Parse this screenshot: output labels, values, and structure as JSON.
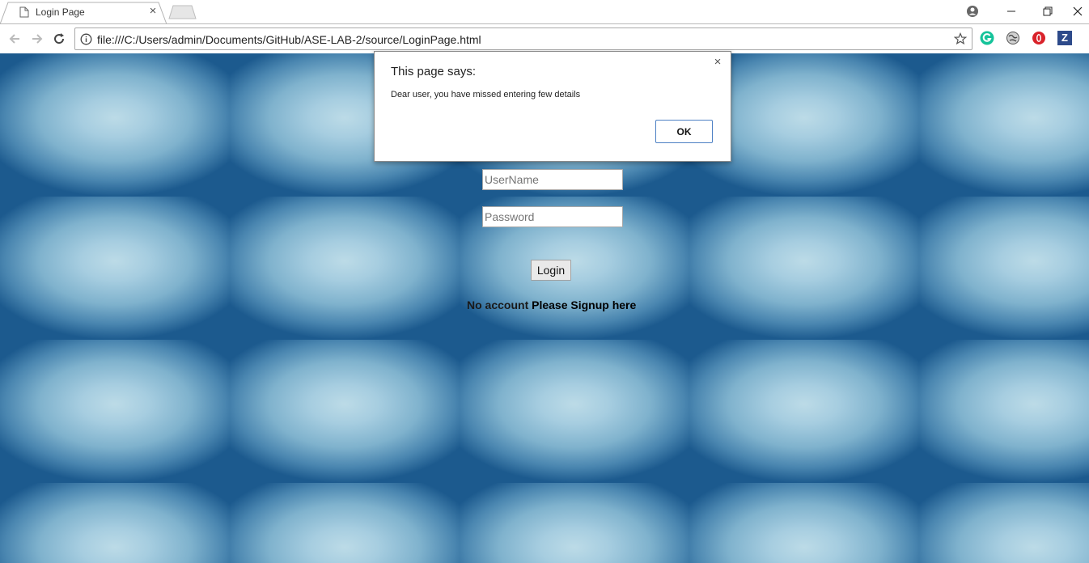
{
  "browser": {
    "tab_title": "Login Page",
    "tab_close": "×",
    "url": "file:///C:/Users/admin/Documents/GitHub/ASE-LAB-2/source/LoginPage.html",
    "extensions": [
      "grammarly-icon",
      "extension-globe-icon",
      "opera-icon",
      "zotero-icon"
    ],
    "ext_z_label": "Z"
  },
  "page": {
    "username_placeholder": "UserName",
    "password_placeholder": "Password",
    "login_label": "Login",
    "signup_prefix": "No account",
    "signup_link": "Please Signup here"
  },
  "dialog": {
    "title": "This page says:",
    "message": "Dear user, you have missed entering few details",
    "ok_label": "OK",
    "close": "×"
  },
  "colors": {
    "dialog_button_border": "#4d80c4",
    "background_blue": "#1c5a8e",
    "background_light": "#bcdbe7"
  }
}
